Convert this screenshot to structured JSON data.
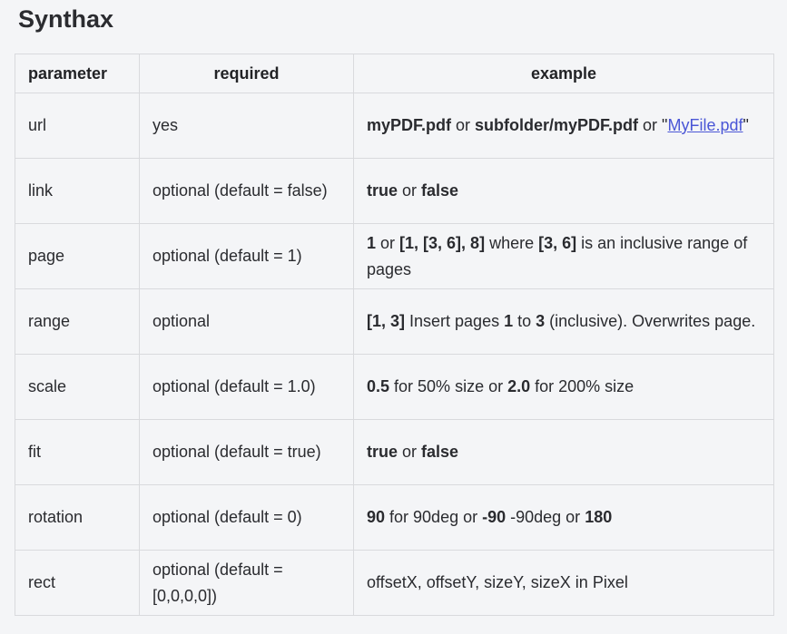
{
  "page": {
    "title": "Synthax"
  },
  "colors": {
    "background": "#f4f5f7",
    "border": "#d9dadd",
    "text": "#2a2b2f",
    "link": "#4a56d6"
  },
  "table": {
    "headers": {
      "parameter": "parameter",
      "required": "required",
      "example": "example"
    },
    "rows": [
      {
        "parameter": "url",
        "required": "yes",
        "example": [
          {
            "text": "myPDF.pdf",
            "style": "bold"
          },
          {
            "text": " or ",
            "style": "normal"
          },
          {
            "text": "subfolder/myPDF.pdf",
            "style": "bold"
          },
          {
            "text": " or \"",
            "style": "normal"
          },
          {
            "text": "MyFile.pdf",
            "style": "link"
          },
          {
            "text": "\"",
            "style": "normal"
          }
        ]
      },
      {
        "parameter": "link",
        "required": "optional (default = false)",
        "example": [
          {
            "text": "true",
            "style": "bold"
          },
          {
            "text": " or ",
            "style": "normal"
          },
          {
            "text": "false",
            "style": "bold"
          }
        ]
      },
      {
        "parameter": "page",
        "required": "optional (default = 1)",
        "example": [
          {
            "text": "1",
            "style": "bold"
          },
          {
            "text": " or ",
            "style": "normal"
          },
          {
            "text": "[1, [3, 6], 8]",
            "style": "bold"
          },
          {
            "text": " where ",
            "style": "normal"
          },
          {
            "text": "[3, 6]",
            "style": "bold"
          },
          {
            "text": " is an inclusive range of pages",
            "style": "normal"
          }
        ]
      },
      {
        "parameter": "range",
        "required": "optional",
        "example": [
          {
            "text": "[1, 3]",
            "style": "bold"
          },
          {
            "text": " Insert pages ",
            "style": "normal"
          },
          {
            "text": "1",
            "style": "bold"
          },
          {
            "text": " to ",
            "style": "normal"
          },
          {
            "text": "3",
            "style": "bold"
          },
          {
            "text": " (inclusive). Overwrites page.",
            "style": "normal"
          }
        ]
      },
      {
        "parameter": "scale",
        "required": "optional (default = 1.0)",
        "example": [
          {
            "text": "0.5",
            "style": "bold"
          },
          {
            "text": " for 50% size or ",
            "style": "normal"
          },
          {
            "text": "2.0",
            "style": "bold"
          },
          {
            "text": " for 200% size",
            "style": "normal"
          }
        ]
      },
      {
        "parameter": "fit",
        "required": "optional (default = true)",
        "example": [
          {
            "text": "true",
            "style": "bold"
          },
          {
            "text": " or ",
            "style": "normal"
          },
          {
            "text": "false",
            "style": "bold"
          }
        ]
      },
      {
        "parameter": "rotation",
        "required": "optional (default = 0)",
        "example": [
          {
            "text": "90",
            "style": "bold"
          },
          {
            "text": " for 90deg or ",
            "style": "normal"
          },
          {
            "text": "-90",
            "style": "bold"
          },
          {
            "text": " -90deg or ",
            "style": "normal"
          },
          {
            "text": "180",
            "style": "bold"
          }
        ]
      },
      {
        "parameter": "rect",
        "required": "optional (default = [0,0,0,0])",
        "example": [
          {
            "text": "offsetX, offsetY, sizeY, sizeX in Pixel",
            "style": "normal"
          }
        ]
      }
    ]
  }
}
